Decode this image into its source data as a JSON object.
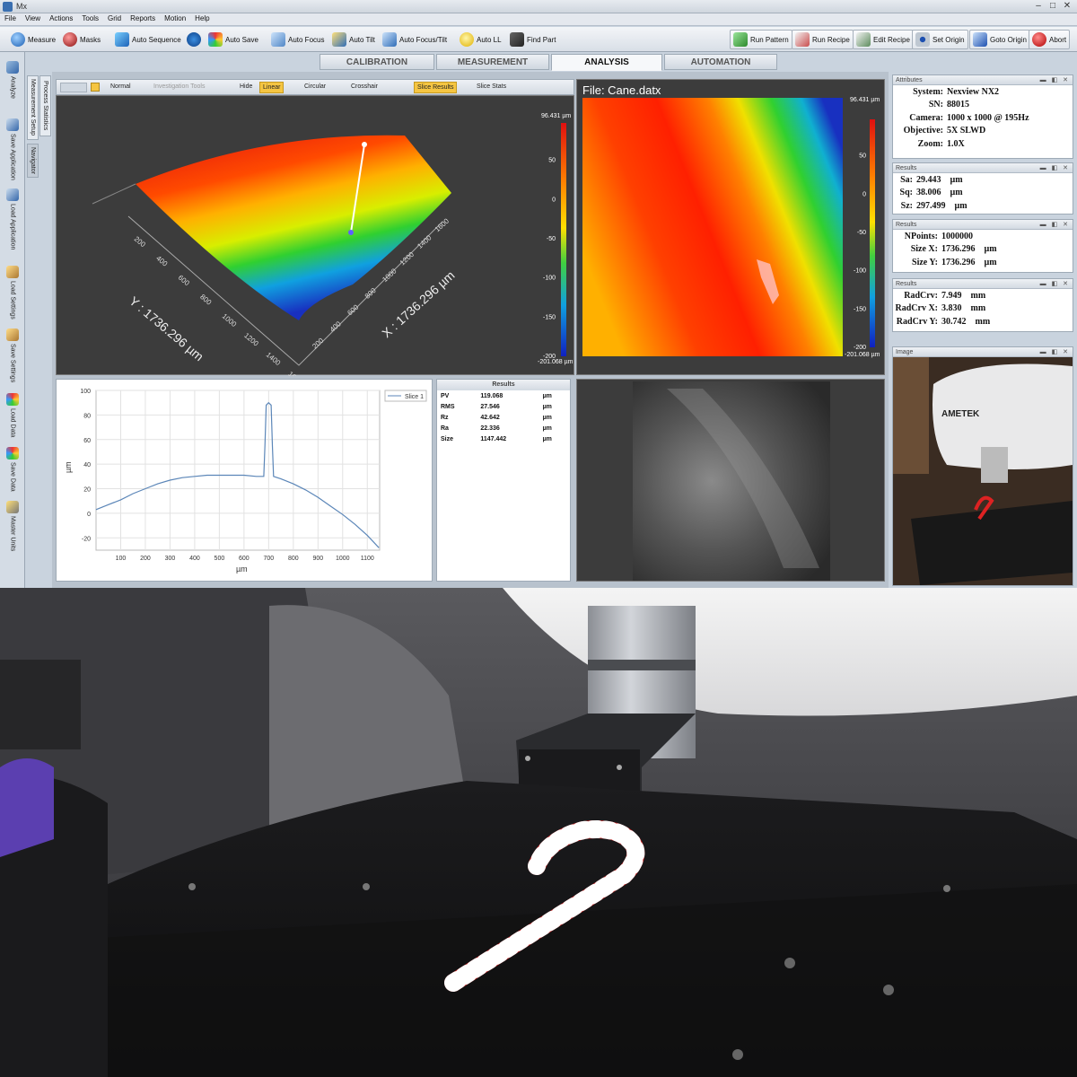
{
  "window": {
    "title": "Mx"
  },
  "menu": [
    "File",
    "View",
    "Actions",
    "Tools",
    "Grid",
    "Reports",
    "Motion",
    "Help"
  ],
  "toolbar_left": [
    "Measure",
    "Masks",
    "Auto Sequence",
    "",
    "Auto Save",
    "Auto Focus",
    "Auto Tilt",
    "Auto Focus/Tilt",
    "Auto LL",
    "Find Part"
  ],
  "toolbar_right": [
    "Run Pattern",
    "Run Recipe",
    "Edit Recipe",
    "Set Origin",
    "Goto Origin",
    "Abort"
  ],
  "tabs": [
    "CALIBRATION",
    "MEASUREMENT",
    "ANALYSIS",
    "AUTOMATION"
  ],
  "left_tools": [
    "Analyze",
    "Save Application",
    "Load Application",
    "Load Settings",
    "Save Settings",
    "Load Data",
    "Save Data",
    "Master Units"
  ],
  "side_tabs": [
    "Process Statistics",
    "Measurement Setup",
    "Navigator"
  ],
  "view_toolbar": {
    "normal": "Normal",
    "investigation": "Investigation Tools",
    "hide": "Hide",
    "linear": "Linear",
    "circular": "Circular",
    "crosshair": "Crosshair",
    "slice_results": "Slice Results",
    "slice_stats": "Slice Stats"
  },
  "plot3d": {
    "x_axis_label": "X : 1736.296 µm",
    "y_axis_label": "Y : 1736.296 µm",
    "x_ticks": [
      "200",
      "400",
      "600",
      "800",
      "1000",
      "1200",
      "1400",
      "1600"
    ],
    "y_ticks": [
      "200",
      "400",
      "600",
      "800",
      "1000",
      "1200",
      "1400",
      "1600"
    ],
    "colorbar": {
      "max": "96.431 µm",
      "min": "-201.068 µm",
      "ticks": [
        "50",
        "0",
        "-50",
        "-100",
        "-150",
        "-200"
      ]
    }
  },
  "plot2d": {
    "file": "File: Cane.datx",
    "colorbar": {
      "max": "96.431 µm",
      "min": "-201.068 µm",
      "ticks": [
        "50",
        "0",
        "-50",
        "-100",
        "-150",
        "-200"
      ]
    }
  },
  "chart_data": {
    "type": "line",
    "xlabel": "µm",
    "ylabel": "µm",
    "xlim": [
      0,
      1150
    ],
    "ylim": [
      -30,
      100
    ],
    "x_ticks": [
      100,
      200,
      300,
      400,
      500,
      600,
      700,
      800,
      900,
      1000,
      1100
    ],
    "y_ticks": [
      -20,
      0,
      20,
      40,
      60,
      80,
      100
    ],
    "legend": "top-right",
    "series": [
      {
        "name": "Slice 1",
        "x": [
          0,
          50,
          100,
          150,
          200,
          250,
          300,
          350,
          400,
          450,
          500,
          550,
          600,
          650,
          680,
          685,
          690,
          700,
          710,
          715,
          720,
          750,
          800,
          850,
          900,
          950,
          1000,
          1050,
          1100,
          1147
        ],
        "y": [
          3,
          7,
          11,
          16,
          20,
          24,
          27,
          29,
          30,
          31,
          31,
          31,
          31,
          30,
          30,
          55,
          88,
          90,
          88,
          55,
          30,
          28,
          24,
          19,
          13,
          6,
          -1,
          -9,
          -18,
          -28
        ]
      }
    ]
  },
  "slice_results": {
    "title": "Results",
    "rows": [
      {
        "name": "PV",
        "value": "119.068",
        "unit": "µm"
      },
      {
        "name": "RMS",
        "value": "27.546",
        "unit": "µm"
      },
      {
        "name": "Rz",
        "value": "42.642",
        "unit": "µm"
      },
      {
        "name": "Ra",
        "value": "22.336",
        "unit": "µm"
      },
      {
        "name": "Size",
        "value": "1147.442",
        "unit": "µm"
      }
    ]
  },
  "attributes": {
    "header": "Attributes",
    "rows": [
      {
        "k": "System:",
        "v": "Nexview NX2"
      },
      {
        "k": "SN:",
        "v": "88015"
      },
      {
        "k": "Camera:",
        "v": "1000 x 1000 @ 195Hz"
      },
      {
        "k": "Objective:",
        "v": "5X SLWD"
      },
      {
        "k": "Zoom:",
        "v": "1.0X"
      }
    ]
  },
  "results1": {
    "header": "Results",
    "rows": [
      {
        "k": "Sa:",
        "v": "29.443",
        "u": "µm"
      },
      {
        "k": "Sq:",
        "v": "38.006",
        "u": "µm"
      },
      {
        "k": "Sz:",
        "v": "297.499",
        "u": "µm"
      }
    ]
  },
  "results2": {
    "header": "Results",
    "rows": [
      {
        "k": "NPoints:",
        "v": "1000000",
        "u": ""
      },
      {
        "k": "Size X:",
        "v": "1736.296",
        "u": "µm"
      },
      {
        "k": "Size Y:",
        "v": "1736.296",
        "u": "µm"
      }
    ]
  },
  "results3": {
    "header": "Results",
    "rows": [
      {
        "k": "RadCrv:",
        "v": "7.949",
        "u": "mm"
      },
      {
        "k": "RadCrv X:",
        "v": "3.830",
        "u": "mm"
      },
      {
        "k": "RadCrv Y:",
        "v": "30.742",
        "u": "mm"
      }
    ]
  },
  "image_panel": {
    "header": "Image",
    "brand": "AMETEK"
  },
  "colors": {
    "accent": "#f5c542",
    "panel_bg": "#3c3c3c",
    "chrome": "#c9d3de"
  }
}
